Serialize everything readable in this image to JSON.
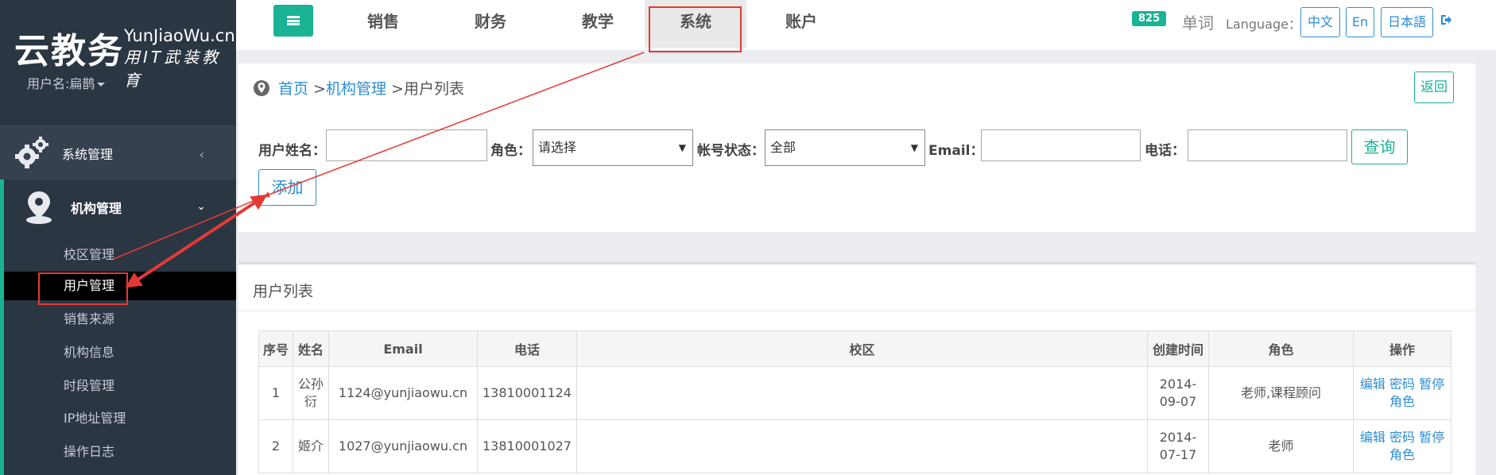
{
  "logo": {
    "main": "云教务",
    "en": "YunJiaoWu.cn",
    "slogan": "用IT武装教育"
  },
  "user": {
    "label": "用户名:扁鹊"
  },
  "sidebar": {
    "system_menu": "系统管理",
    "org_menu": "机构管理",
    "sub_items": [
      "校区管理",
      "用户管理",
      "销售来源",
      "机构信息",
      "时段管理",
      "IP地址管理",
      "操作日志"
    ],
    "active_sub": "用户管理"
  },
  "topnav": {
    "tabs": [
      "销售",
      "财务",
      "教学",
      "系统",
      "账户"
    ],
    "active": "系统"
  },
  "header": {
    "badge": "825",
    "words": "单词",
    "language_label": "Language：",
    "langs": [
      "中文",
      "En",
      "日本語"
    ]
  },
  "breadcrumb": {
    "home": "首页",
    "sep1": " >",
    "org": "机构管理",
    "sep2": " >",
    "current": "用户列表"
  },
  "buttons": {
    "back": "返回",
    "query": "查询",
    "add": "添加"
  },
  "filters": {
    "name_label": "用户姓名：",
    "role_label": "角色：",
    "role_value": "请选择",
    "status_label": "帐号状态：",
    "status_value": "全部",
    "email_label": "Email：",
    "phone_label": "电话："
  },
  "list": {
    "title": "用户列表",
    "columns": [
      "序号",
      "姓名",
      "Email",
      "电话",
      "校区",
      "创建时间",
      "角色",
      "操作"
    ],
    "rows": [
      {
        "no": "1",
        "name": "公孙衍",
        "email": "1124@yunjiaowu.cn",
        "phone": "13810001124",
        "campus": "",
        "created": "2014-09-07",
        "role": "老师,课程顾问",
        "ops": [
          "编辑",
          "密码",
          "暂停",
          "角色"
        ]
      },
      {
        "no": "2",
        "name": "姬介",
        "email": "1027@yunjiaowu.cn",
        "phone": "13810001027",
        "campus": "",
        "created": "2014-07-17",
        "role": "老师",
        "ops": [
          "编辑",
          "密码",
          "暂停",
          "角色"
        ]
      }
    ]
  },
  "colors": {
    "accent": "#1ab394",
    "link": "#2e8ed3",
    "sidebar_bg": "#2b3643",
    "annotation": "#e53935"
  }
}
